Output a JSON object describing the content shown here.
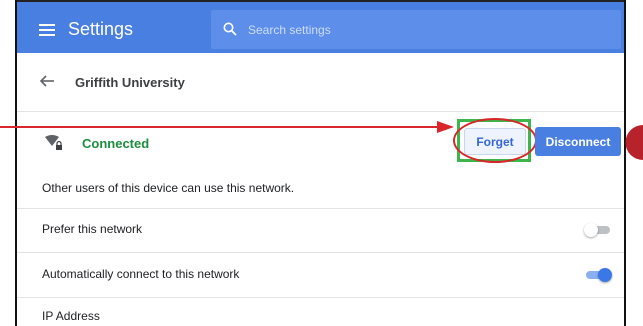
{
  "header": {
    "title": "Settings",
    "search_placeholder": "Search settings"
  },
  "subheader": {
    "title": "Griffith University"
  },
  "network": {
    "status": "Connected",
    "forget_label": "Forget",
    "disconnect_label": "Disconnect"
  },
  "info_text": "Other users of this device can use this network.",
  "rows": [
    {
      "label": "Prefer this network",
      "toggle": "off"
    },
    {
      "label": "Automatically connect to this network",
      "toggle": "on"
    },
    {
      "label": "IP Address"
    }
  ],
  "colors": {
    "header_bg": "#4a7fe2",
    "connected_green": "#1e8e3e",
    "highlight_green": "#3cb54a",
    "annotation_red": "#d8262b"
  },
  "icons": [
    "menu-icon",
    "search-icon",
    "back-arrow-icon",
    "wifi-secure-icon"
  ]
}
